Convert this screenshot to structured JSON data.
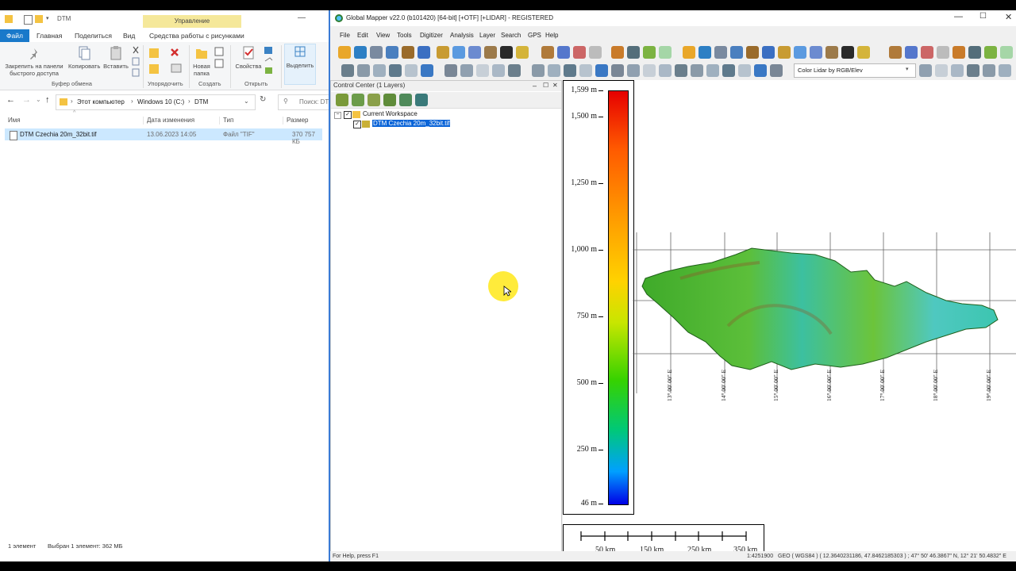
{
  "explorer": {
    "title": "DTM",
    "ribbon_context": "Управление",
    "tabs": [
      "Файл",
      "Главная",
      "Поделиться",
      "Вид",
      "Средства работы с рисунками"
    ],
    "clipboard": {
      "pin_label": "Закрепить на панели быстрого доступа",
      "copy_label": "Копировать",
      "paste_label": "Вставить",
      "group": "Буфер обмена"
    },
    "organize_group": "Упорядочить",
    "new": {
      "folder_label": "Новая папка",
      "group": "Создать"
    },
    "open": {
      "properties_label": "Свойства",
      "group": "Открыть"
    },
    "select_label": "Выделить",
    "breadcrumb": [
      "Этот компьютер",
      "Windows 10 (C:)",
      "DTM"
    ],
    "search_placeholder": "Поиск: DTM",
    "columns": [
      "Имя",
      "Дата изменения",
      "Тип",
      "Размер"
    ],
    "files": [
      {
        "name": "DTM Czechia 20m_32bit.tif",
        "date": "13.06.2023 14:05",
        "type": "Файл \"TIF\"",
        "size": "370 757 КБ"
      }
    ],
    "status_count": "1 элемент",
    "status_selected": "Выбран 1 элемент: 362 МБ"
  },
  "gm": {
    "title": "Global Mapper v22.0 (b101420) [64-bit] [+OTF] [+LIDAR] - REGISTERED",
    "menu": [
      "File",
      "Edit",
      "View",
      "Tools",
      "Digitizer",
      "Analysis",
      "Layer",
      "Search",
      "GPS",
      "Help"
    ],
    "color_dropdown": "Color Lidar by RGB/Elev",
    "control_center": {
      "title": "Control Center (1 Layers)",
      "workspace": "Current Workspace",
      "layer": "DTM Czechia 20m_32bit.tif"
    },
    "legend": {
      "labels": [
        "1,599 m",
        "1,500 m",
        "1,250 m",
        "1,000 m",
        "750 m",
        "500 m",
        "250 m",
        "46 m"
      ],
      "values": [
        1599,
        1500,
        1250,
        1000,
        750,
        500,
        250,
        46
      ],
      "min": 46,
      "max": 1599
    },
    "scale_labels": [
      "50 km",
      "150 km",
      "250 km",
      "350 km"
    ],
    "longitudes": [
      "13° 00' 00\" E",
      "14° 00' 00\" E",
      "15° 00' 00\" E",
      "16° 00' 00\" E",
      "17° 00' 00\" E",
      "18° 00' 00\" E",
      "19° 00' 00\" E"
    ],
    "status_help": "For Help, press F1",
    "status_scale": "1:4251900",
    "status_coords": "GEO ( WGS84 ) ( 12.3640231186, 47.8462185303 ) ; 47° 50' 46.3867\" N, 12° 21' 50.4832\" E"
  }
}
